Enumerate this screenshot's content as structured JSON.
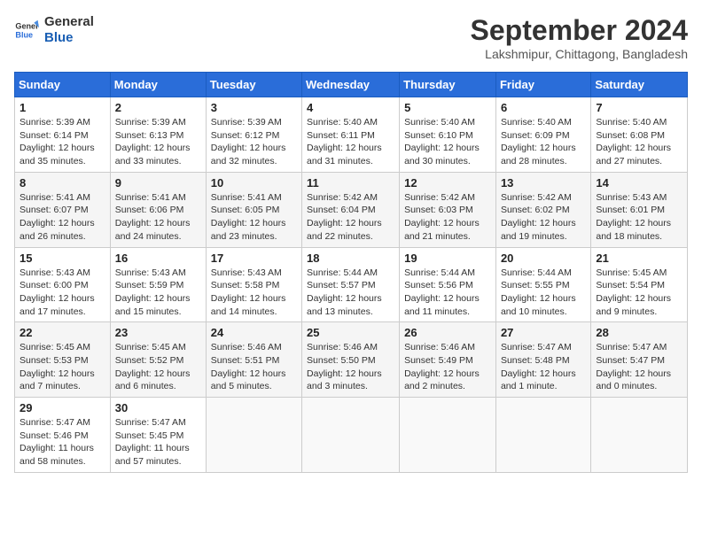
{
  "logo": {
    "line1": "General",
    "line2": "Blue"
  },
  "title": "September 2024",
  "location": "Lakshmipur, Chittagong, Bangladesh",
  "weekdays": [
    "Sunday",
    "Monday",
    "Tuesday",
    "Wednesday",
    "Thursday",
    "Friday",
    "Saturday"
  ],
  "weeks": [
    [
      {
        "day": "1",
        "info": "Sunrise: 5:39 AM\nSunset: 6:14 PM\nDaylight: 12 hours\nand 35 minutes."
      },
      {
        "day": "2",
        "info": "Sunrise: 5:39 AM\nSunset: 6:13 PM\nDaylight: 12 hours\nand 33 minutes."
      },
      {
        "day": "3",
        "info": "Sunrise: 5:39 AM\nSunset: 6:12 PM\nDaylight: 12 hours\nand 32 minutes."
      },
      {
        "day": "4",
        "info": "Sunrise: 5:40 AM\nSunset: 6:11 PM\nDaylight: 12 hours\nand 31 minutes."
      },
      {
        "day": "5",
        "info": "Sunrise: 5:40 AM\nSunset: 6:10 PM\nDaylight: 12 hours\nand 30 minutes."
      },
      {
        "day": "6",
        "info": "Sunrise: 5:40 AM\nSunset: 6:09 PM\nDaylight: 12 hours\nand 28 minutes."
      },
      {
        "day": "7",
        "info": "Sunrise: 5:40 AM\nSunset: 6:08 PM\nDaylight: 12 hours\nand 27 minutes."
      }
    ],
    [
      {
        "day": "8",
        "info": "Sunrise: 5:41 AM\nSunset: 6:07 PM\nDaylight: 12 hours\nand 26 minutes."
      },
      {
        "day": "9",
        "info": "Sunrise: 5:41 AM\nSunset: 6:06 PM\nDaylight: 12 hours\nand 24 minutes."
      },
      {
        "day": "10",
        "info": "Sunrise: 5:41 AM\nSunset: 6:05 PM\nDaylight: 12 hours\nand 23 minutes."
      },
      {
        "day": "11",
        "info": "Sunrise: 5:42 AM\nSunset: 6:04 PM\nDaylight: 12 hours\nand 22 minutes."
      },
      {
        "day": "12",
        "info": "Sunrise: 5:42 AM\nSunset: 6:03 PM\nDaylight: 12 hours\nand 21 minutes."
      },
      {
        "day": "13",
        "info": "Sunrise: 5:42 AM\nSunset: 6:02 PM\nDaylight: 12 hours\nand 19 minutes."
      },
      {
        "day": "14",
        "info": "Sunrise: 5:43 AM\nSunset: 6:01 PM\nDaylight: 12 hours\nand 18 minutes."
      }
    ],
    [
      {
        "day": "15",
        "info": "Sunrise: 5:43 AM\nSunset: 6:00 PM\nDaylight: 12 hours\nand 17 minutes."
      },
      {
        "day": "16",
        "info": "Sunrise: 5:43 AM\nSunset: 5:59 PM\nDaylight: 12 hours\nand 15 minutes."
      },
      {
        "day": "17",
        "info": "Sunrise: 5:43 AM\nSunset: 5:58 PM\nDaylight: 12 hours\nand 14 minutes."
      },
      {
        "day": "18",
        "info": "Sunrise: 5:44 AM\nSunset: 5:57 PM\nDaylight: 12 hours\nand 13 minutes."
      },
      {
        "day": "19",
        "info": "Sunrise: 5:44 AM\nSunset: 5:56 PM\nDaylight: 12 hours\nand 11 minutes."
      },
      {
        "day": "20",
        "info": "Sunrise: 5:44 AM\nSunset: 5:55 PM\nDaylight: 12 hours\nand 10 minutes."
      },
      {
        "day": "21",
        "info": "Sunrise: 5:45 AM\nSunset: 5:54 PM\nDaylight: 12 hours\nand 9 minutes."
      }
    ],
    [
      {
        "day": "22",
        "info": "Sunrise: 5:45 AM\nSunset: 5:53 PM\nDaylight: 12 hours\nand 7 minutes."
      },
      {
        "day": "23",
        "info": "Sunrise: 5:45 AM\nSunset: 5:52 PM\nDaylight: 12 hours\nand 6 minutes."
      },
      {
        "day": "24",
        "info": "Sunrise: 5:46 AM\nSunset: 5:51 PM\nDaylight: 12 hours\nand 5 minutes."
      },
      {
        "day": "25",
        "info": "Sunrise: 5:46 AM\nSunset: 5:50 PM\nDaylight: 12 hours\nand 3 minutes."
      },
      {
        "day": "26",
        "info": "Sunrise: 5:46 AM\nSunset: 5:49 PM\nDaylight: 12 hours\nand 2 minutes."
      },
      {
        "day": "27",
        "info": "Sunrise: 5:47 AM\nSunset: 5:48 PM\nDaylight: 12 hours\nand 1 minute."
      },
      {
        "day": "28",
        "info": "Sunrise: 5:47 AM\nSunset: 5:47 PM\nDaylight: 12 hours\nand 0 minutes."
      }
    ],
    [
      {
        "day": "29",
        "info": "Sunrise: 5:47 AM\nSunset: 5:46 PM\nDaylight: 11 hours\nand 58 minutes."
      },
      {
        "day": "30",
        "info": "Sunrise: 5:47 AM\nSunset: 5:45 PM\nDaylight: 11 hours\nand 57 minutes."
      },
      null,
      null,
      null,
      null,
      null
    ]
  ]
}
